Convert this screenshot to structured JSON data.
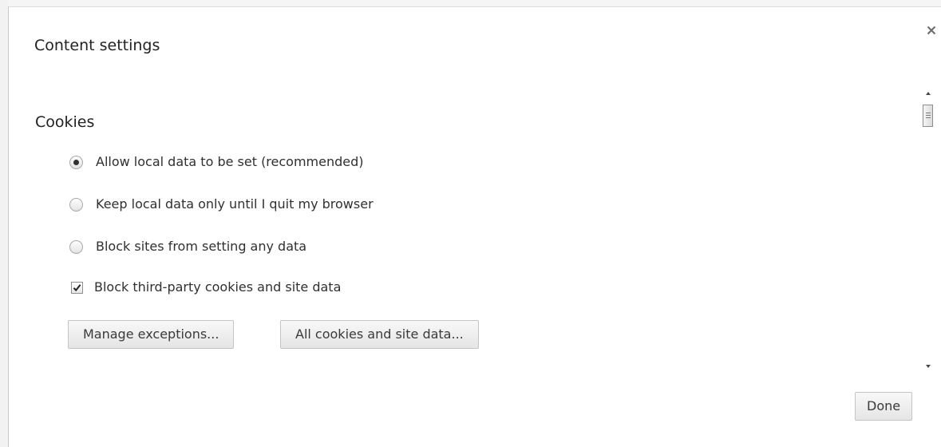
{
  "dialog": {
    "title": "Content settings",
    "close_icon": "close-icon"
  },
  "cookies": {
    "heading": "Cookies",
    "options": [
      {
        "label": "Allow local data to be set (recommended)",
        "selected": true
      },
      {
        "label": "Keep local data only until I quit my browser",
        "selected": false
      },
      {
        "label": "Block sites from setting any data",
        "selected": false
      }
    ],
    "third_party": {
      "label": "Block third-party cookies and site data",
      "checked": true
    },
    "buttons": {
      "manage_exceptions": "Manage exceptions...",
      "all_cookies": "All cookies and site data..."
    }
  },
  "footer": {
    "done_label": "Done"
  },
  "icons": {
    "scroll_up": "chevron-up-icon",
    "scroll_down": "chevron-down-icon",
    "checkmark": "checkmark-icon"
  }
}
